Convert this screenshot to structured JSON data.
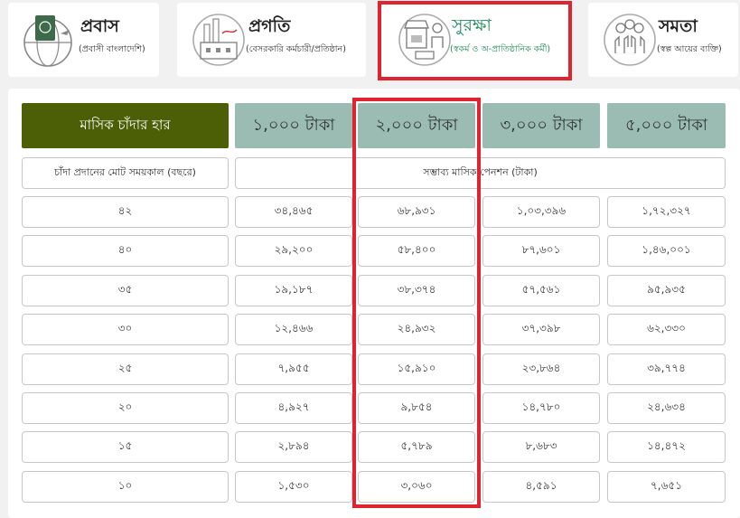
{
  "cards": [
    {
      "title": "প্রবাস",
      "subtitle": "(প্রবাসী বাংলাদেশি)",
      "icon": "passport-globe-icon",
      "active": false
    },
    {
      "title": "প্রগতি",
      "subtitle": "(বেসরকারি কর্মচারী/প্রতিষ্ঠান)",
      "icon": "factory-icon",
      "active": false
    },
    {
      "title": "সুরক্ষা",
      "subtitle": "(স্বকর্ম ও অ-প্রাতিষ্ঠানিক কর্মী)",
      "icon": "shop-worker-icon",
      "active": true
    },
    {
      "title": "সমতা",
      "subtitle": "(স্বল্প আয়ের ব্যক্তি)",
      "icon": "people-hands-icon",
      "active": false
    }
  ],
  "table": {
    "rate_header": "মাসিক চাঁদার হার",
    "amount_headers": [
      "১,০০০ টাকা",
      "২,০০০ টাকা",
      "৩,০০০ টাকা",
      "৫,০০০ টাকা"
    ],
    "duration_label": "চাঁদা প্রদানের মোট সময়কাল (বছরে)",
    "pension_label": "সম্ভাব্য মাসিক পেনশন (টাকা)",
    "rows": [
      {
        "years": "৪২",
        "values": [
          "৩৪,৪৬৫",
          "৬৮,৯৩১",
          "১,০৩,৩৯৬",
          "১,৭২,৩২৭"
        ]
      },
      {
        "years": "৪০",
        "values": [
          "২৯,২০০",
          "৫৮,৪০০",
          "৮৭,৬০১",
          "১,৪৬,০০১"
        ]
      },
      {
        "years": "৩৫",
        "values": [
          "১৯,১৮৭",
          "৩৮,৩৭৪",
          "৫৭,৫৬১",
          "৯৫,৯৩৫"
        ]
      },
      {
        "years": "৩০",
        "values": [
          "১২,৪৬৬",
          "২৪,৯৩২",
          "৩৭,৩৯৮",
          "৬২,৩৩০"
        ]
      },
      {
        "years": "২৫",
        "values": [
          "৭,৯৫৫",
          "১৫,৯১০",
          "২৩,৮৬৪",
          "৩৯,৭৭৪"
        ]
      },
      {
        "years": "২০",
        "values": [
          "৪,৯২৭",
          "৯,৮৫৪",
          "১৪,৭৮০",
          "২৪,৬৩৪"
        ]
      },
      {
        "years": "১৫",
        "values": [
          "২,৮৯৪",
          "৫,৭৮৯",
          "৮,৬৮৩",
          "১৪,৪৭২"
        ]
      },
      {
        "years": "১০",
        "values": [
          "১,৫৩০",
          "৩,০৬০",
          "৪,৫৯১",
          "৭,৬৫১"
        ]
      }
    ]
  },
  "colors": {
    "rate_header_bg": "#4c5e06",
    "amount_header_bg": "#9bbcb3",
    "active_text": "#1f8a5a",
    "highlight": "#e0242f"
  }
}
